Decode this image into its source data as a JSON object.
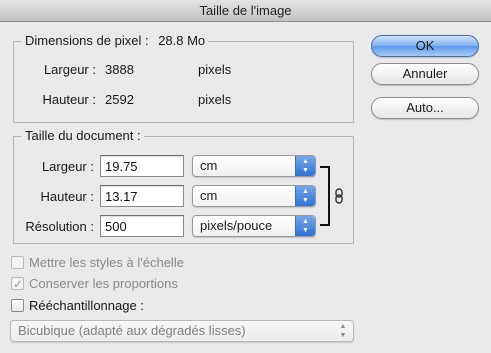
{
  "window": {
    "title": "Taille de l'image"
  },
  "pixel_dimensions": {
    "legend": "Dimensions de pixel :",
    "size": "28.8 Mo",
    "width_label": "Largeur :",
    "width_value": "3888",
    "width_unit": "pixels",
    "height_label": "Hauteur :",
    "height_value": "2592",
    "height_unit": "pixels"
  },
  "document_size": {
    "legend": "Taille du document :",
    "width_label": "Largeur :",
    "width_value": "19.75",
    "width_unit": "cm",
    "height_label": "Hauteur :",
    "height_value": "13.17",
    "height_unit": "cm",
    "resolution_label": "Résolution :",
    "resolution_value": "500",
    "resolution_unit": "pixels/pouce"
  },
  "buttons": {
    "ok": "OK",
    "cancel": "Annuler",
    "auto": "Auto..."
  },
  "options": {
    "scale_styles": {
      "label": "Mettre les styles à l'échelle",
      "checked": false,
      "enabled": false
    },
    "constrain": {
      "label": "Conserver les proportions",
      "checked": true,
      "enabled": false
    },
    "resample": {
      "label": "Rééchantillonnage :",
      "checked": false,
      "enabled": true
    },
    "method": {
      "value": "Bicubique (adapté aux dégradés lisses)",
      "enabled": false
    }
  },
  "icons": {
    "link": "chain-link-icon",
    "select_arrows": "up-down-arrows-icon",
    "check": "checkmark-icon"
  },
  "colors": {
    "default_button": "#5d98ea",
    "dropdown_arrow": "#2f72d4"
  }
}
